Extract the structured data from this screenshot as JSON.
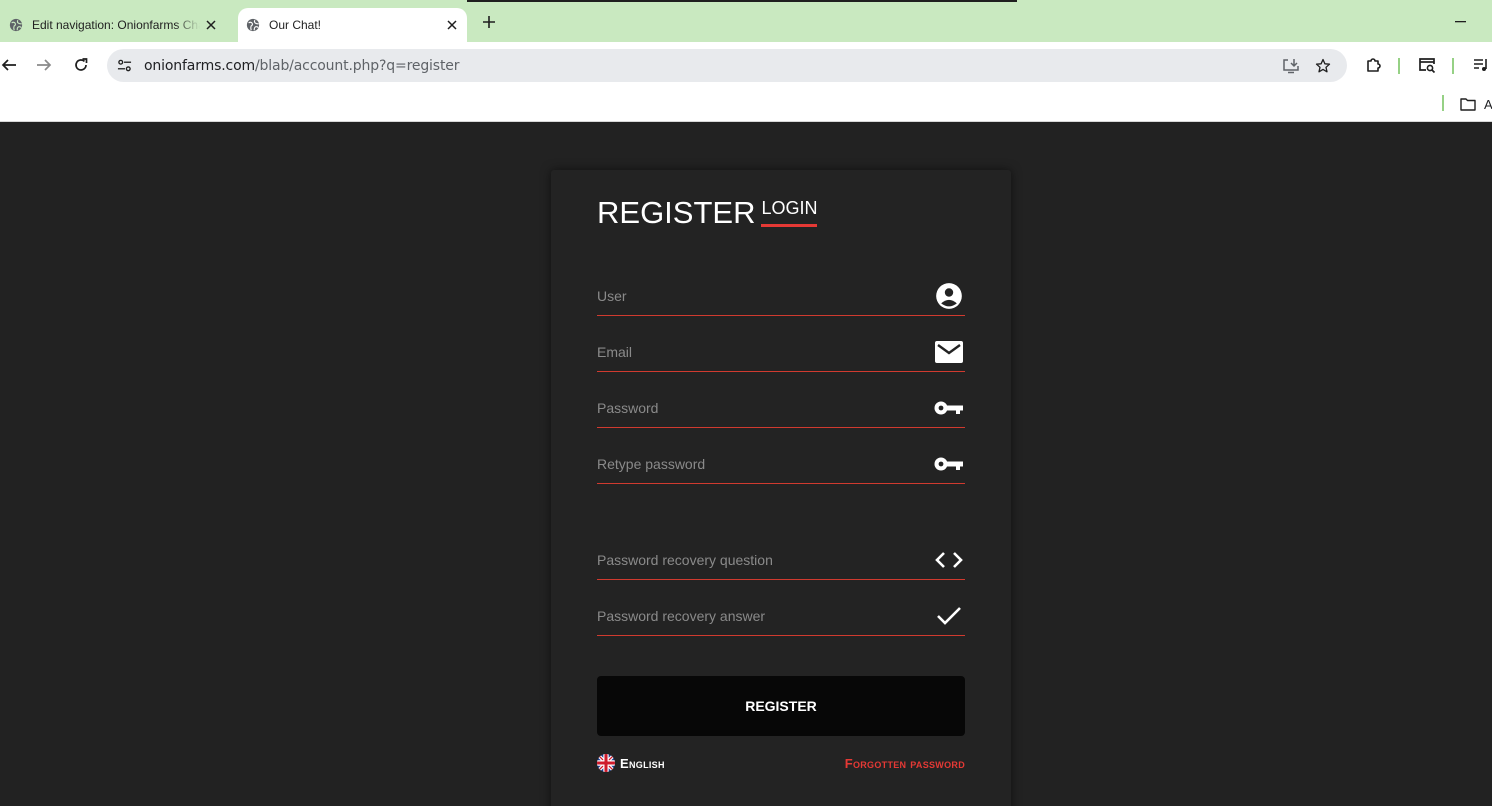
{
  "browser": {
    "tabs": [
      {
        "title": "Edit navigation: Onionfarms Chat",
        "icon": "globe-icon",
        "active": false
      },
      {
        "title": "Our Chat!",
        "icon": "globe-icon",
        "active": true
      }
    ],
    "address": {
      "host": "onionfarms.com",
      "path": "/blab/account.php?q=register"
    },
    "bookmarks": {
      "folder_label": "A"
    },
    "colors": {
      "tabstrip": "#c9e9c0",
      "toolbar": "#ffffff",
      "omnibox": "#e8eaed",
      "separator": "#96d185"
    }
  },
  "form": {
    "title": "REGISTER",
    "login_link": "LOGIN",
    "fields": [
      {
        "placeholder": "User",
        "icon": "account-circle-icon"
      },
      {
        "placeholder": "Email",
        "icon": "mail-icon"
      },
      {
        "placeholder": "Password",
        "icon": "key-icon"
      },
      {
        "placeholder": "Retype password",
        "icon": "key-icon"
      },
      {
        "placeholder": "Password recovery question",
        "icon": "code-icon"
      },
      {
        "placeholder": "Password recovery answer",
        "icon": "check-icon"
      }
    ],
    "submit_label": "REGISTER",
    "language": {
      "label": "English",
      "icon": "uk-flag-icon"
    },
    "forgot_label": "Forgotten password",
    "colors": {
      "page_bg": "#222222",
      "card_bg": "#232323",
      "accent": "#e53935",
      "underline": "#d03a2f",
      "button_bg": "#070707"
    }
  }
}
